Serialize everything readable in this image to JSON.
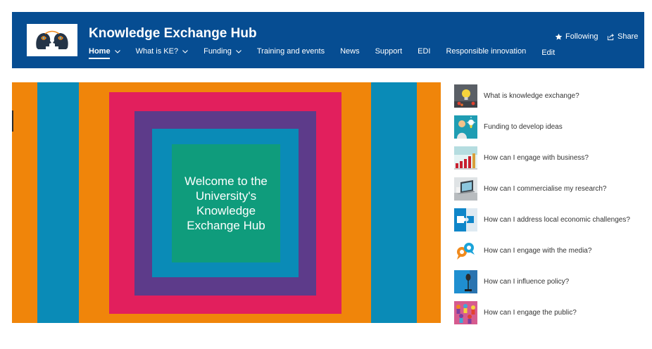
{
  "header": {
    "site_title": "Knowledge Exchange Hub",
    "bg_color": "#064d92",
    "nav": [
      {
        "label": "Home",
        "has_dropdown": true,
        "active": true
      },
      {
        "label": "What is KE?",
        "has_dropdown": true
      },
      {
        "label": "Funding",
        "has_dropdown": true
      },
      {
        "label": "Training and events"
      },
      {
        "label": "News"
      },
      {
        "label": "Support"
      },
      {
        "label": "EDI"
      },
      {
        "label": "Responsible innovation"
      },
      {
        "label": "Edit"
      }
    ],
    "following_label": "Following",
    "share_label": "Share"
  },
  "hero": {
    "text": "Welcome to the University's Knowledge Exchange Hub",
    "colors": {
      "orange": "#f0850a",
      "blue": "#0a8bb7",
      "pink": "#e21f5d",
      "purple": "#5d3b8a",
      "teal": "#0f9c7c"
    }
  },
  "quick_links": [
    {
      "label": "What is knowledge exchange?",
      "icon": "lightbulb-icon"
    },
    {
      "label": "Funding to develop ideas",
      "icon": "idea-person-icon"
    },
    {
      "label": "How can I engage with business?",
      "icon": "bar-chart-icon"
    },
    {
      "label": "How can I commercialise my research?",
      "icon": "laptop-icon"
    },
    {
      "label": "How can I address local economic challenges?",
      "icon": "puzzle-icon"
    },
    {
      "label": "How can I engage with the media?",
      "icon": "speech-bubbles-icon"
    },
    {
      "label": "How can I influence policy?",
      "icon": "microphone-icon"
    },
    {
      "label": "How can I engage the public?",
      "icon": "crowd-icon"
    }
  ]
}
